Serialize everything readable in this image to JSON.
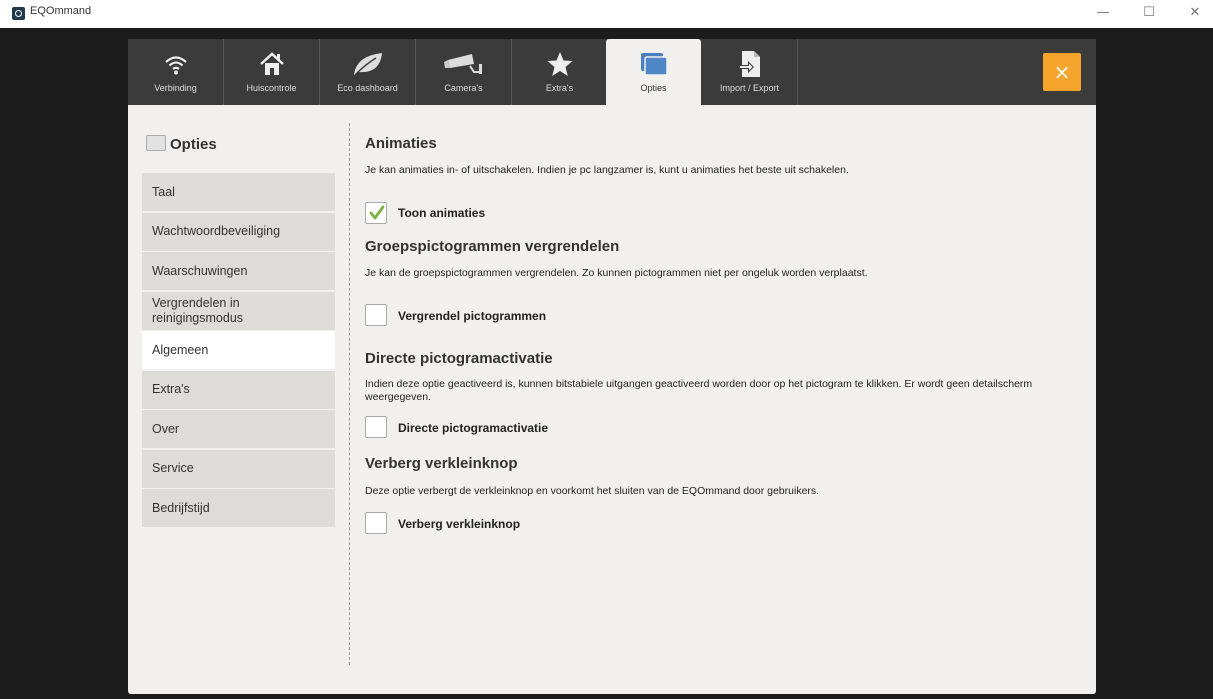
{
  "window": {
    "title": "EQOmmand",
    "minimize": "—",
    "maximize": "☐",
    "close": "✕"
  },
  "tabs": [
    {
      "label": "Verbinding",
      "icon": "wifi-icon"
    },
    {
      "label": "Huiscontrole",
      "icon": "house-icon"
    },
    {
      "label": "Eco dashboard",
      "icon": "leaf-icon"
    },
    {
      "label": "Camera's",
      "icon": "camera-icon"
    },
    {
      "label": "Extra's",
      "icon": "star-icon"
    },
    {
      "label": "Opties",
      "icon": "options-icon",
      "active": true
    },
    {
      "label": "Import / Export",
      "icon": "import-export-icon"
    }
  ],
  "close_button": "×",
  "sidebar": {
    "title": "Opties",
    "items": [
      {
        "label": "Taal"
      },
      {
        "label": "Wachtwoordbeveiliging"
      },
      {
        "label": "Waarschuwingen"
      },
      {
        "label": "Vergrendelen in reinigingsmodus"
      },
      {
        "label": "Algemeen",
        "active": true
      },
      {
        "label": "Extra's"
      },
      {
        "label": "Over"
      },
      {
        "label": "Service"
      },
      {
        "label": "Bedrijfstijd"
      }
    ]
  },
  "sections": [
    {
      "title": "Animaties",
      "description": "Je kan animaties in- of uitschakelen. Indien je pc langzamer is, kunt u animaties het beste uit schakelen.",
      "checkbox_label": "Toon animaties",
      "checked": true
    },
    {
      "title": "Groepspictogrammen vergrendelen",
      "description": "Je kan de groepspictogrammen vergrendelen. Zo kunnen pictogrammen niet per ongeluk worden verplaatst.",
      "checkbox_label": "Vergrendel pictogrammen",
      "checked": false
    },
    {
      "title": "Directe pictogramactivatie",
      "description": "Indien deze optie geactiveerd is, kunnen bitstabiele uitgangen geactiveerd worden door op het pictogram te klikken. Er wordt geen detailscherm weergegeven.",
      "checkbox_label": "Directe pictogramactivatie",
      "checked": false
    },
    {
      "title": "Verberg verkleinknop",
      "description": "Deze optie verbergt de verkleinknop en voorkomt het sluiten van de EQOmmand door gebruikers.",
      "checkbox_label": "Verberg verkleinknop",
      "checked": false
    }
  ]
}
